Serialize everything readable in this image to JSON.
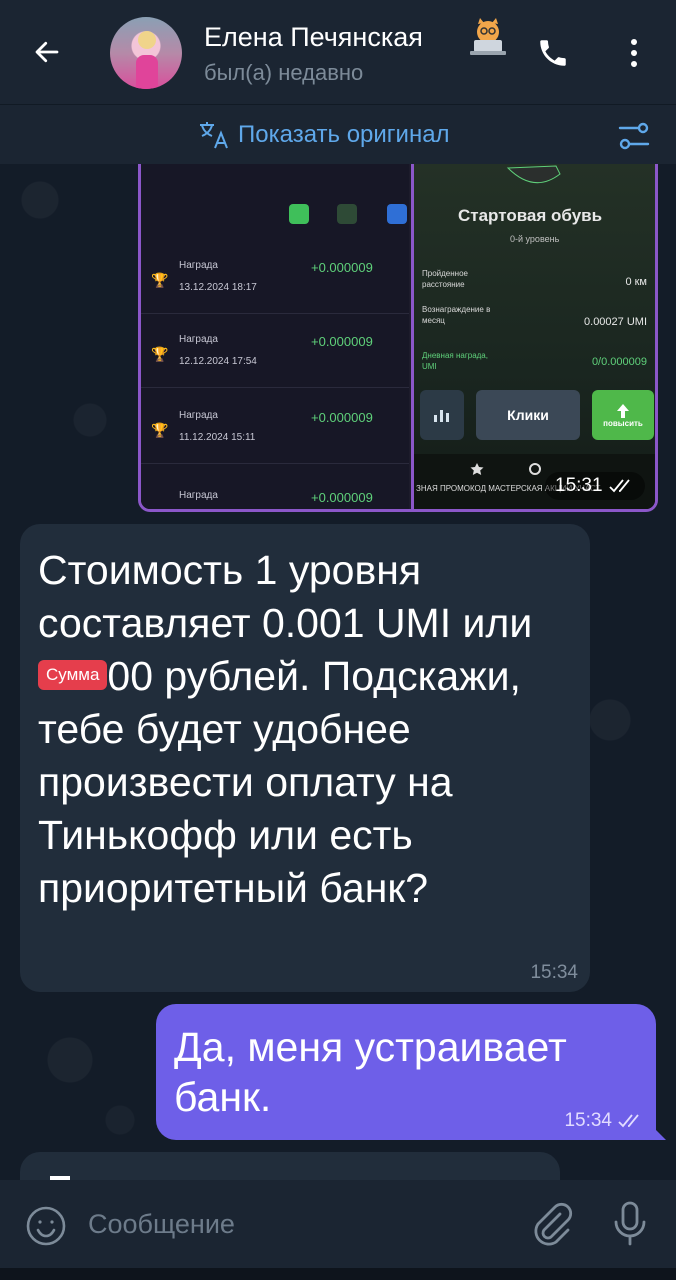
{
  "header": {
    "contact_name": "Елена Печянская",
    "status": "был(а) недавно",
    "back_icon": "arrow-left-icon",
    "call_icon": "phone-icon",
    "menu_icon": "more-vertical-icon"
  },
  "translate_bar": {
    "label": "Показать оригинал",
    "icon": "translate-icon",
    "settings_icon": "sliders-icon"
  },
  "image_message": {
    "left_screen": {
      "rewards": [
        {
          "label": "Награда",
          "date": "13.12.2024 18:17",
          "amount": "+0.000009"
        },
        {
          "label": "Награда",
          "date": "12.12.2024 17:54",
          "amount": "+0.000009"
        },
        {
          "label": "Награда",
          "date": "11.12.2024 15:11",
          "amount": "+0.000009"
        },
        {
          "label": "Награда",
          "date": "",
          "amount": "+0.000009"
        }
      ]
    },
    "right_screen": {
      "title": "Стартовая обувь",
      "level": "0-й уровень",
      "rows": [
        {
          "label": "Пройденное расстояние",
          "value": "0 км"
        },
        {
          "label": "Вознаграждение в месяц",
          "value": "0.00027 UMI"
        },
        {
          "label": "Дневная награда, UMI",
          "value": "0/0.000009"
        }
      ],
      "clicks_button": "Клики",
      "upgrade_button": "повысить",
      "nav_text": "ЗНАЯ  ПРОМОКОД МАСТЕРСКАЯ  АКЦИИ  УЧАСТ"
    },
    "time": "15:31"
  },
  "incoming_message": {
    "text_before": "Стоимость 1 уровня составляет 0.001 UMI или ",
    "badge": "Сумма",
    "text_after": "00 рублей. Подскажи, тебе  будет удобнее произвести оплату на Тинькофф или есть приоритетный банк?",
    "time": "15:34"
  },
  "outgoing_message": {
    "text": "Да, меня устраивает банк.",
    "time": "15:34"
  },
  "composer": {
    "placeholder": "Сообщение",
    "emoji_icon": "smile-icon",
    "attach_icon": "paperclip-icon",
    "mic_icon": "microphone-icon"
  },
  "colors": {
    "header_bg": "#1b2532",
    "incoming_bg": "#212d3b",
    "outgoing_bg": "#6e5fe8",
    "accent": "#5fa8ea",
    "badge": "#e53e4c"
  }
}
